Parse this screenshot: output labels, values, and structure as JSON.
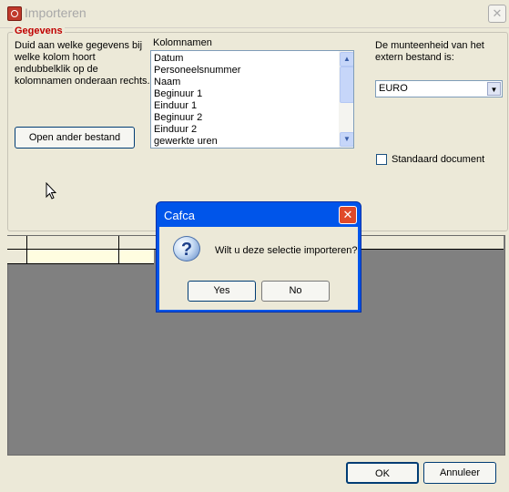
{
  "window": {
    "title": "Importeren",
    "close_symbol": "✕"
  },
  "group": {
    "legend": "Gegevens",
    "help_lines": [
      "Duid aan welke gegevens bij",
      "welke kolom hoort",
      "endubbelklik op de",
      "kolomnamen onderaan rechts."
    ],
    "columns_label": "Kolomnamen",
    "columns": [
      "Datum",
      "Personeelsnummer",
      "Naam",
      "Beginuur 1",
      "Einduur 1",
      "Beginuur 2",
      "Einduur 2",
      "gewerkte uren"
    ],
    "open_button": "Open ander bestand",
    "currency_label_lines": [
      "De munteenheid van het",
      "extern bestand is:"
    ],
    "currency_value": "EURO",
    "checkbox_label": "Standaard document",
    "checkbox_checked": false
  },
  "footer": {
    "ok": "OK",
    "cancel": "Annuleer"
  },
  "dialog": {
    "title": "Cafca",
    "close_symbol": "✕",
    "icon_glyph": "?",
    "message": "Wilt u deze selectie importeren?",
    "yes": "Yes",
    "no": "No"
  }
}
